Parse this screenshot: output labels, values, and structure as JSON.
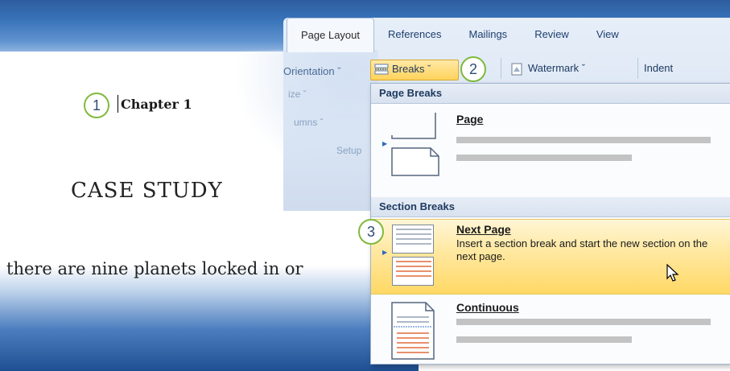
{
  "ribbon": {
    "tabs": [
      {
        "label": "Page Layout",
        "active": true
      },
      {
        "label": "References",
        "active": false
      },
      {
        "label": "Mailings",
        "active": false
      },
      {
        "label": "Review",
        "active": false
      },
      {
        "label": "View",
        "active": false
      }
    ],
    "orientation_label": "Orientation ˇ",
    "breaks_label": "Breaks ˇ",
    "watermark_label": "Watermark ˇ",
    "indent_label": "Indent",
    "size_ghost": "ize ˇ",
    "columns_ghost": "umns ˇ",
    "setup_ghost": "Setup"
  },
  "callouts": {
    "one": "1",
    "two": "2",
    "three": "3"
  },
  "document": {
    "chapter": "Chapter 1",
    "case_study": "CASE STUDY",
    "body_line": "there are nine planets locked in or"
  },
  "menu": {
    "page_breaks_header": "Page Breaks",
    "page_item_title": "Page",
    "section_breaks_header": "Section Breaks",
    "next_page_title": "Next Page",
    "next_page_desc": "Insert a section break and start the new section on the next page.",
    "continuous_title": "Continuous"
  },
  "colors": {
    "accent_blue": "#3a74ba",
    "highlight": "#ffd865",
    "callout_border": "#7fba3c"
  }
}
